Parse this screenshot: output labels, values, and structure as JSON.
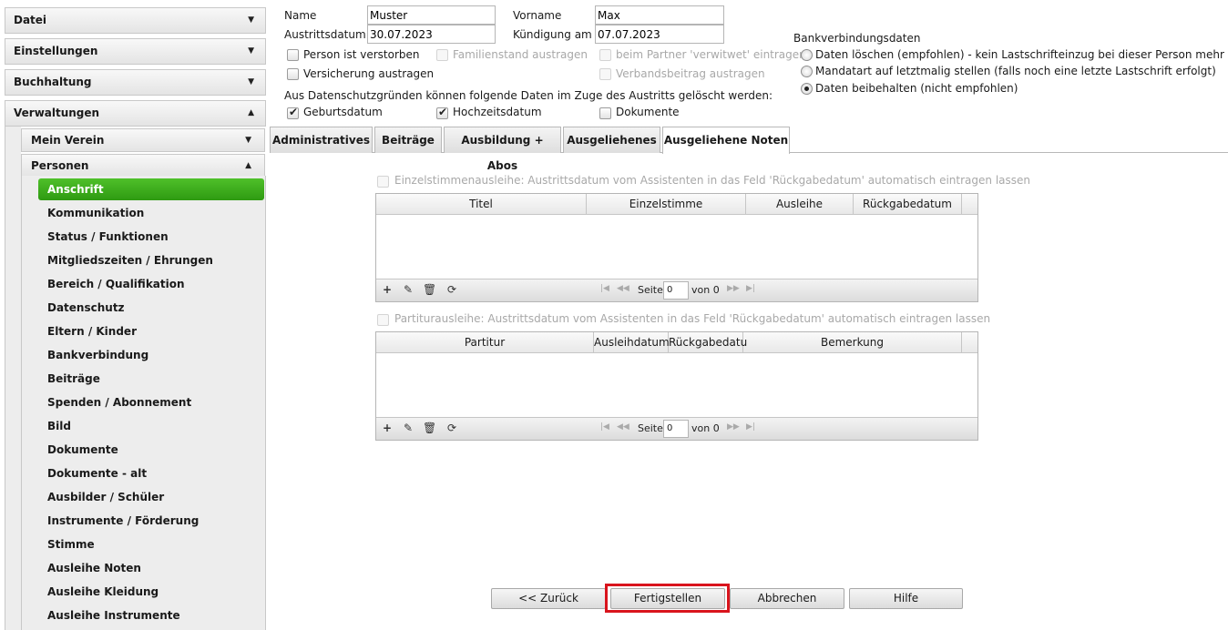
{
  "sidebar": {
    "top_sections": [
      {
        "label": "Datei",
        "arrow": "▼"
      },
      {
        "label": "Einstellungen",
        "arrow": "▼"
      },
      {
        "label": "Buchhaltung",
        "arrow": "▼"
      },
      {
        "label": "Verwaltungen",
        "arrow": "▲"
      }
    ],
    "sub_sections": [
      {
        "label": "Mein Verein",
        "arrow": "▼"
      },
      {
        "label": "Personen",
        "arrow": "▲"
      }
    ],
    "items": [
      "Anschrift",
      "Kommunikation",
      "Status / Funktionen",
      "Mitgliedszeiten / Ehrungen",
      "Bereich / Qualifikation",
      "Datenschutz",
      "Eltern / Kinder",
      "Bankverbindung",
      "Beiträge",
      "Spenden / Abonnement",
      "Bild",
      "Dokumente",
      "Dokumente - alt",
      "Ausbilder / Schüler",
      "Instrumente / Förderung",
      "Stimme",
      "Ausleihe Noten",
      "Ausleihe Kleidung",
      "Ausleihe Instrumente"
    ],
    "active_item": "Anschrift"
  },
  "form": {
    "name_label": "Name",
    "name_value": "Muster",
    "vorname_label": "Vorname",
    "vorname_value": "Max",
    "austritt_label": "Austrittsdatum",
    "austritt_value": "30.07.2023",
    "kuendigung_label": "Kündigung am",
    "kuendigung_value": "07.07.2023",
    "cb_verstorben": "Person ist verstorben",
    "cb_familienstand": "Familienstand austragen",
    "cb_partner": "beim Partner 'verwitwet' eintragen",
    "cb_versicherung": "Versicherung austragen",
    "cb_verbandsbeitrag": "Verbandsbeitrag austragen",
    "datenschutz_text": "Aus Datenschutzgründen können folgende Daten im Zuge des Austritts gelöscht werden:",
    "cb_geburtsdatum": "Geburtsdatum",
    "cb_hochzeitsdatum": "Hochzeitsdatum",
    "cb_dokumente": "Dokumente"
  },
  "bank": {
    "title": "Bankverbindungsdaten",
    "options": [
      "Daten löschen (empfohlen) - kein Lastschrifteinzug bei dieser Person mehr möglich",
      "Mandatart auf letztmalig stellen (falls noch eine letzte Lastschrift erfolgt)",
      "Daten beibehalten (nicht empfohlen)"
    ],
    "selected_index": 2
  },
  "tabs": [
    "Administratives",
    "Beiträge",
    "Ausbildung + Abos",
    "Ausgeliehenes",
    "Ausgeliehene Noten"
  ],
  "active_tab": "Ausgeliehene Noten",
  "grid1": {
    "checkbox_label": "Einzelstimmenausleihe: Austrittsdatum vom Assistenten in das Feld 'Rückgabedatum' automatisch eintragen lassen",
    "columns": [
      "Titel",
      "Einzelstimme",
      "Ausleihe",
      "Rückgabedatum"
    ],
    "page_label": "Seite",
    "page_value": "0",
    "of_label": "von 0"
  },
  "grid2": {
    "checkbox_label": "Partiturausleihe: Austrittsdatum vom Assistenten in das Feld 'Rückgabedatum' automatisch eintragen lassen",
    "columns": [
      "Partitur",
      "Ausleihdatum",
      "Rückgabedatu",
      "Bemerkung"
    ],
    "page_label": "Seite",
    "page_value": "0",
    "of_label": "von 0"
  },
  "toolbar_icons": [
    "add-icon",
    "edit-icon",
    "delete-icon",
    "refresh-icon"
  ],
  "buttons": {
    "back": "<< Zurück",
    "finish": "Fertigstellen",
    "cancel": "Abbrechen",
    "help": "Hilfe"
  },
  "colors": {
    "active_nav": "#3aa81a",
    "highlight": "#d9141d"
  }
}
